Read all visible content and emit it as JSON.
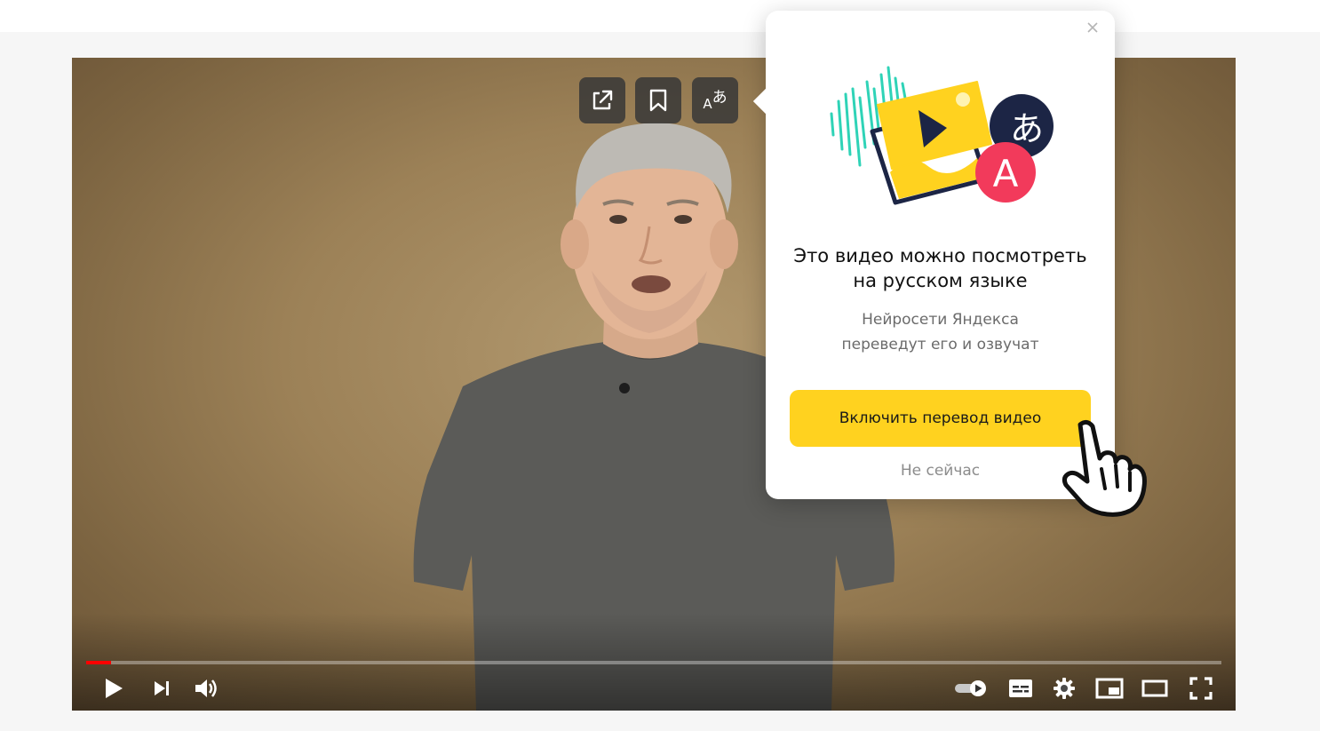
{
  "overlay": {
    "buttons": [
      {
        "name": "open-external-button",
        "icon": "external-link-icon"
      },
      {
        "name": "bookmark-button",
        "icon": "bookmark-icon"
      },
      {
        "name": "translate-button",
        "icon": "translate-icon",
        "glyph_latin": "A",
        "glyph_jp": "あ"
      }
    ]
  },
  "popup": {
    "title_line1": "Это видео можно посмотреть",
    "title_line2": "на русском языке",
    "subtitle_line1": "Нейросети Яндекса",
    "subtitle_line2": "переведут его и озвучат",
    "primary_button": "Включить перевод видео",
    "secondary_button": "Не сейчас",
    "illustration": {
      "badge_latin": "A",
      "badge_jp": "あ"
    }
  },
  "player": {
    "progress": 0.022,
    "controls": [
      "play-icon",
      "next-icon",
      "volume-icon",
      "autoplay-toggle-icon",
      "subtitles-icon",
      "settings-gear-icon",
      "miniplayer-icon",
      "theater-mode-icon",
      "fullscreen-icon"
    ]
  },
  "colors": {
    "accent_yellow": "#ffd21f",
    "progress_red": "#ff0000",
    "badge_red": "#f23a5b",
    "badge_navy": "#1c2545",
    "wave_teal": "#2fd3b7"
  }
}
